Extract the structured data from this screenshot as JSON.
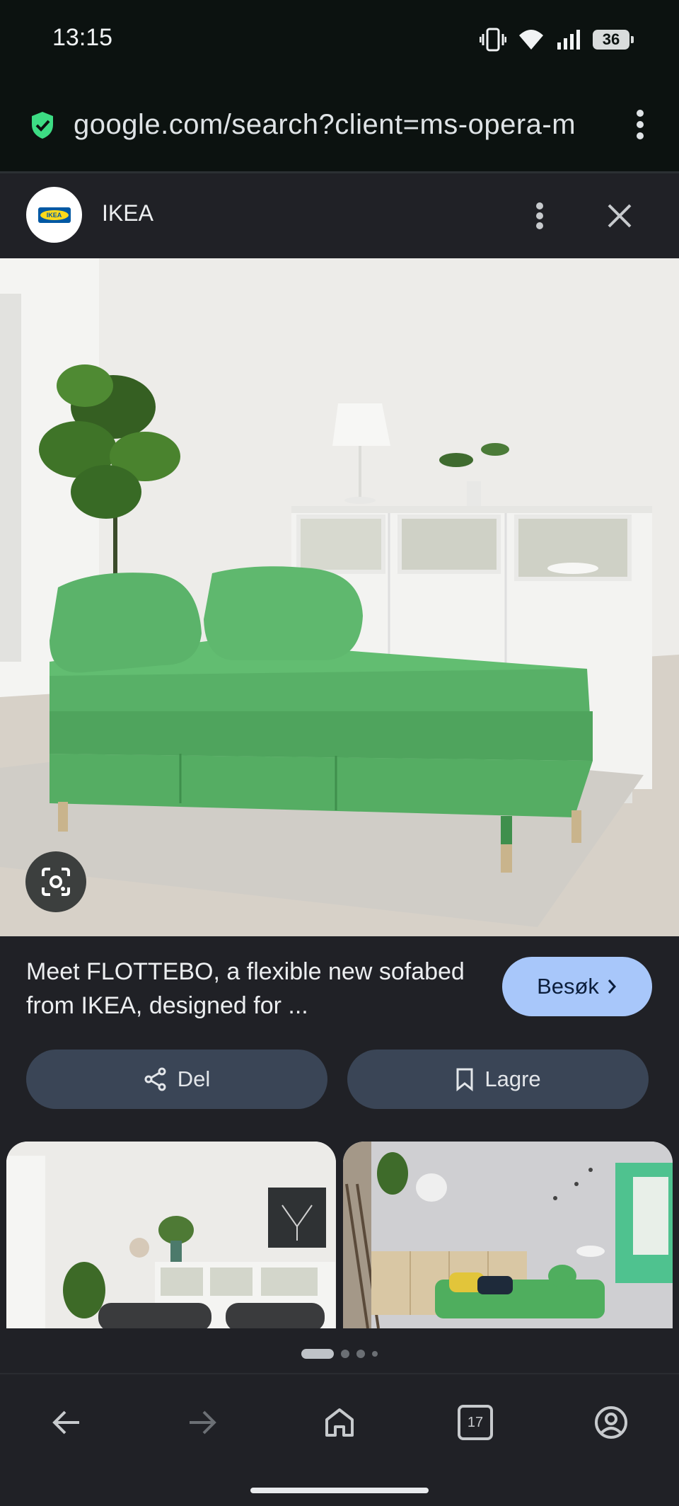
{
  "status_bar": {
    "time": "13:15",
    "battery": "36",
    "icons": [
      "vibrate-icon",
      "wifi-icon",
      "signal-icon",
      "battery-icon"
    ]
  },
  "url_bar": {
    "url": "google.com/search?client=ms-opera-m",
    "secure_icon": "shield-check-icon",
    "menu_icon": "more-vertical-icon"
  },
  "sheet_header": {
    "site_name": "IKEA",
    "logo_text": "IKEA",
    "more_icon": "more-vertical-icon",
    "close_icon": "close-icon"
  },
  "image": {
    "lens_icon": "google-lens-icon"
  },
  "info": {
    "caption": "Meet FLOTTEBO, a flexible new sofabed from IKEA, designed for ...",
    "visit_label": "Besøk",
    "share_label": "Del",
    "save_label": "Lagre"
  },
  "pager": {
    "active_index": 0,
    "count": 4
  },
  "bottom_nav": {
    "tab_count": "17",
    "items": [
      "back-icon",
      "forward-icon",
      "home-icon",
      "tabs-icon",
      "account-icon"
    ]
  },
  "colors": {
    "sheet_bg": "#202126",
    "visit_button": "#a8c7fa",
    "action_button": "#3a4556",
    "secure_green": "#3ddc84",
    "sofa_green": "#5cb96b"
  }
}
